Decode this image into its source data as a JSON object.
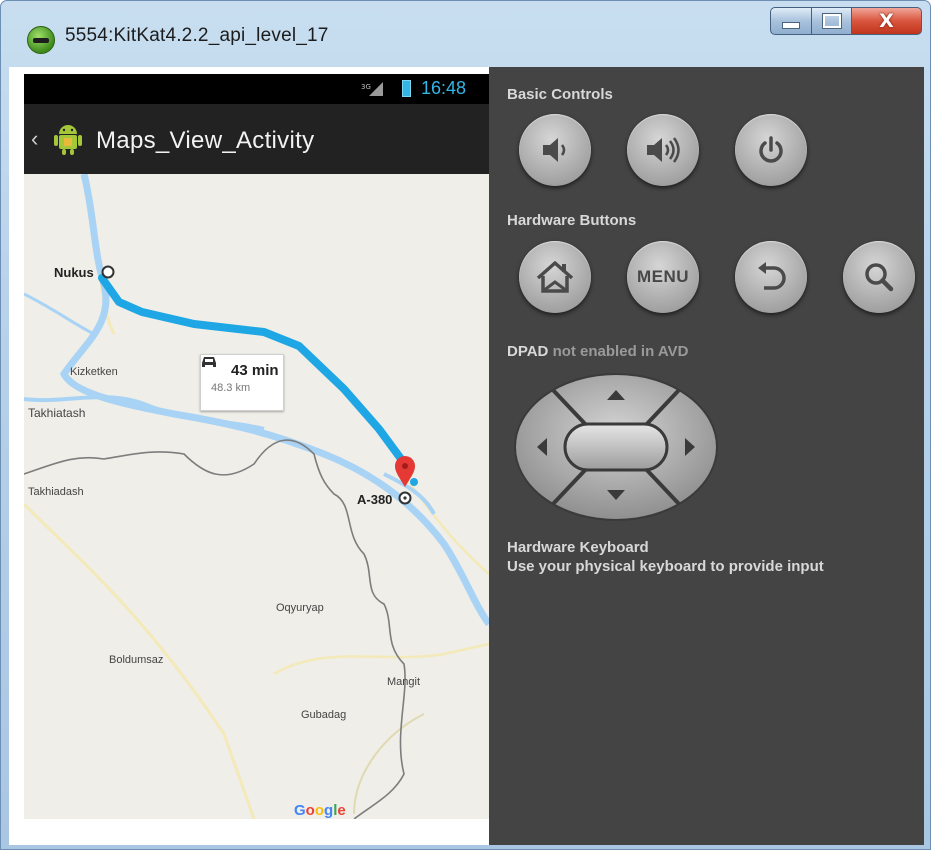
{
  "window": {
    "title": "5554:KitKat4.2.2_api_level_17",
    "minimize_icon": "minimize-icon",
    "maximize_icon": "maximize-icon",
    "close_glyph": "X"
  },
  "phone": {
    "status_bar": {
      "time": "16:48",
      "signal_icon": "signal-icon",
      "battery_icon": "battery-icon"
    },
    "action_bar": {
      "title": "Maps_View_Activity",
      "back_glyph": "‹",
      "app_icon": "android-icon"
    },
    "map": {
      "places": [
        "Nukus",
        "Kizketken",
        "Takhiatash",
        "Takhiadash",
        "A-380",
        "Oqyuryap",
        "Boldumsaz",
        "Mangit",
        "Gubadag"
      ],
      "route_time": "43 min",
      "route_distance": "48.3 km",
      "logo": "Google"
    }
  },
  "panel": {
    "basic_controls_title": "Basic Controls",
    "hardware_buttons_title": "Hardware Buttons",
    "dpad_title_bold": "DPAD",
    "dpad_title_rest": "not enabled in AVD",
    "hardware_keyboard_title": "Hardware Keyboard",
    "hardware_keyboard_desc": "Use your physical keyboard to provide input",
    "menu_label": "MENU",
    "colors": {
      "panel_bg": "#444444",
      "accent_blue": "#33b5e5",
      "route_blue": "#1ea7e4",
      "pin_red": "#e53935"
    }
  }
}
